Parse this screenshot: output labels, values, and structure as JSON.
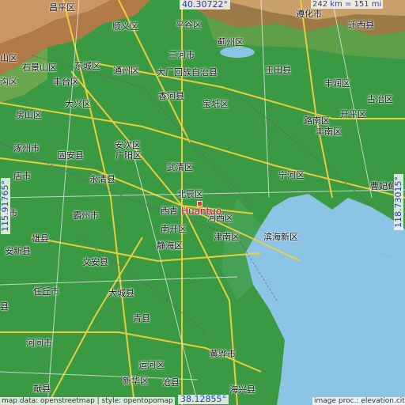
{
  "map": {
    "city": "Huantuo",
    "coords": {
      "top": "40.30722°",
      "bottom": "38.12855°",
      "left": "115.91765°",
      "right": "118.73015°"
    },
    "scale": "242 km = 151 mi",
    "attribution": "map data: openstreetmap | style: opentopomap",
    "credit": "image proc.: elevation.city",
    "colors": {
      "lowland": "#3a9a44",
      "sea": "#8bc4e4",
      "mountain": "#b07a46",
      "road_major": "#f2cf3a",
      "road_minor": "#e8e8e8",
      "coord_text": "#2a3cb4",
      "city_marker": "#ff2a2a"
    },
    "labels": [
      {
        "id": "l1",
        "text": "昌平区"
      },
      {
        "id": "l2",
        "text": "顺义区"
      },
      {
        "id": "l3",
        "text": "平谷区"
      },
      {
        "id": "l4",
        "text": "遵化市"
      },
      {
        "id": "l5",
        "text": "迁西县"
      },
      {
        "id": "l6",
        "text": "蓟州区"
      },
      {
        "id": "l7",
        "text": "石景山区"
      },
      {
        "id": "l8",
        "text": "东城区"
      },
      {
        "id": "l9",
        "text": "三河市"
      },
      {
        "id": "l10",
        "text": "通州区"
      },
      {
        "id": "l11",
        "text": "大厂回族自治县"
      },
      {
        "id": "l12",
        "text": "玉田县"
      },
      {
        "id": "l13",
        "text": "丰台区"
      },
      {
        "id": "l14",
        "text": "丰润区"
      },
      {
        "id": "l15",
        "text": "大兴区"
      },
      {
        "id": "l16",
        "text": "香河县"
      },
      {
        "id": "l17",
        "text": "宝坻区"
      },
      {
        "id": "l18",
        "text": "古冶区"
      },
      {
        "id": "l19",
        "text": "房山区"
      },
      {
        "id": "l20",
        "text": "路南区"
      },
      {
        "id": "l21",
        "text": "开平区"
      },
      {
        "id": "l22",
        "text": "丰南区"
      },
      {
        "id": "l23",
        "text": "涿州市"
      },
      {
        "id": "l24",
        "text": "固安县"
      },
      {
        "id": "l25",
        "text": "安次区"
      },
      {
        "id": "l26",
        "text": "广阳区"
      },
      {
        "id": "l27",
        "text": "武清区"
      },
      {
        "id": "l28",
        "text": "宁河区"
      },
      {
        "id": "l29",
        "text": "永清县"
      },
      {
        "id": "l30",
        "text": "曹妃甸"
      },
      {
        "id": "l31",
        "text": "北辰区"
      },
      {
        "id": "l32",
        "text": "霸州市"
      },
      {
        "id": "l33",
        "text": "西青"
      },
      {
        "id": "l34",
        "text": "河西区"
      },
      {
        "id": "l35",
        "text": "雄县"
      },
      {
        "id": "l36",
        "text": "南开区"
      },
      {
        "id": "l37",
        "text": "津南区"
      },
      {
        "id": "l38",
        "text": "滨海新区"
      },
      {
        "id": "l39",
        "text": "安新县"
      },
      {
        "id": "l40",
        "text": "静海区"
      },
      {
        "id": "l41",
        "text": "文安县"
      },
      {
        "id": "l42",
        "text": "任丘市"
      },
      {
        "id": "l43",
        "text": "大城县"
      },
      {
        "id": "l44",
        "text": "青县"
      },
      {
        "id": "l45",
        "text": "河间市"
      },
      {
        "id": "l46",
        "text": "黄骅市"
      },
      {
        "id": "l47",
        "text": "运河区"
      },
      {
        "id": "l48",
        "text": "献县"
      },
      {
        "id": "l49",
        "text": "新华区"
      },
      {
        "id": "l50",
        "text": "沧县"
      },
      {
        "id": "l51",
        "text": "海兴县"
      },
      {
        "id": "l52",
        "text": "店市"
      },
      {
        "id": "l53",
        "text": "县"
      },
      {
        "id": "l54",
        "text": "沟区"
      },
      {
        "id": "l55",
        "text": "山区"
      },
      {
        "id": "l56",
        "text": "州市"
      }
    ]
  }
}
